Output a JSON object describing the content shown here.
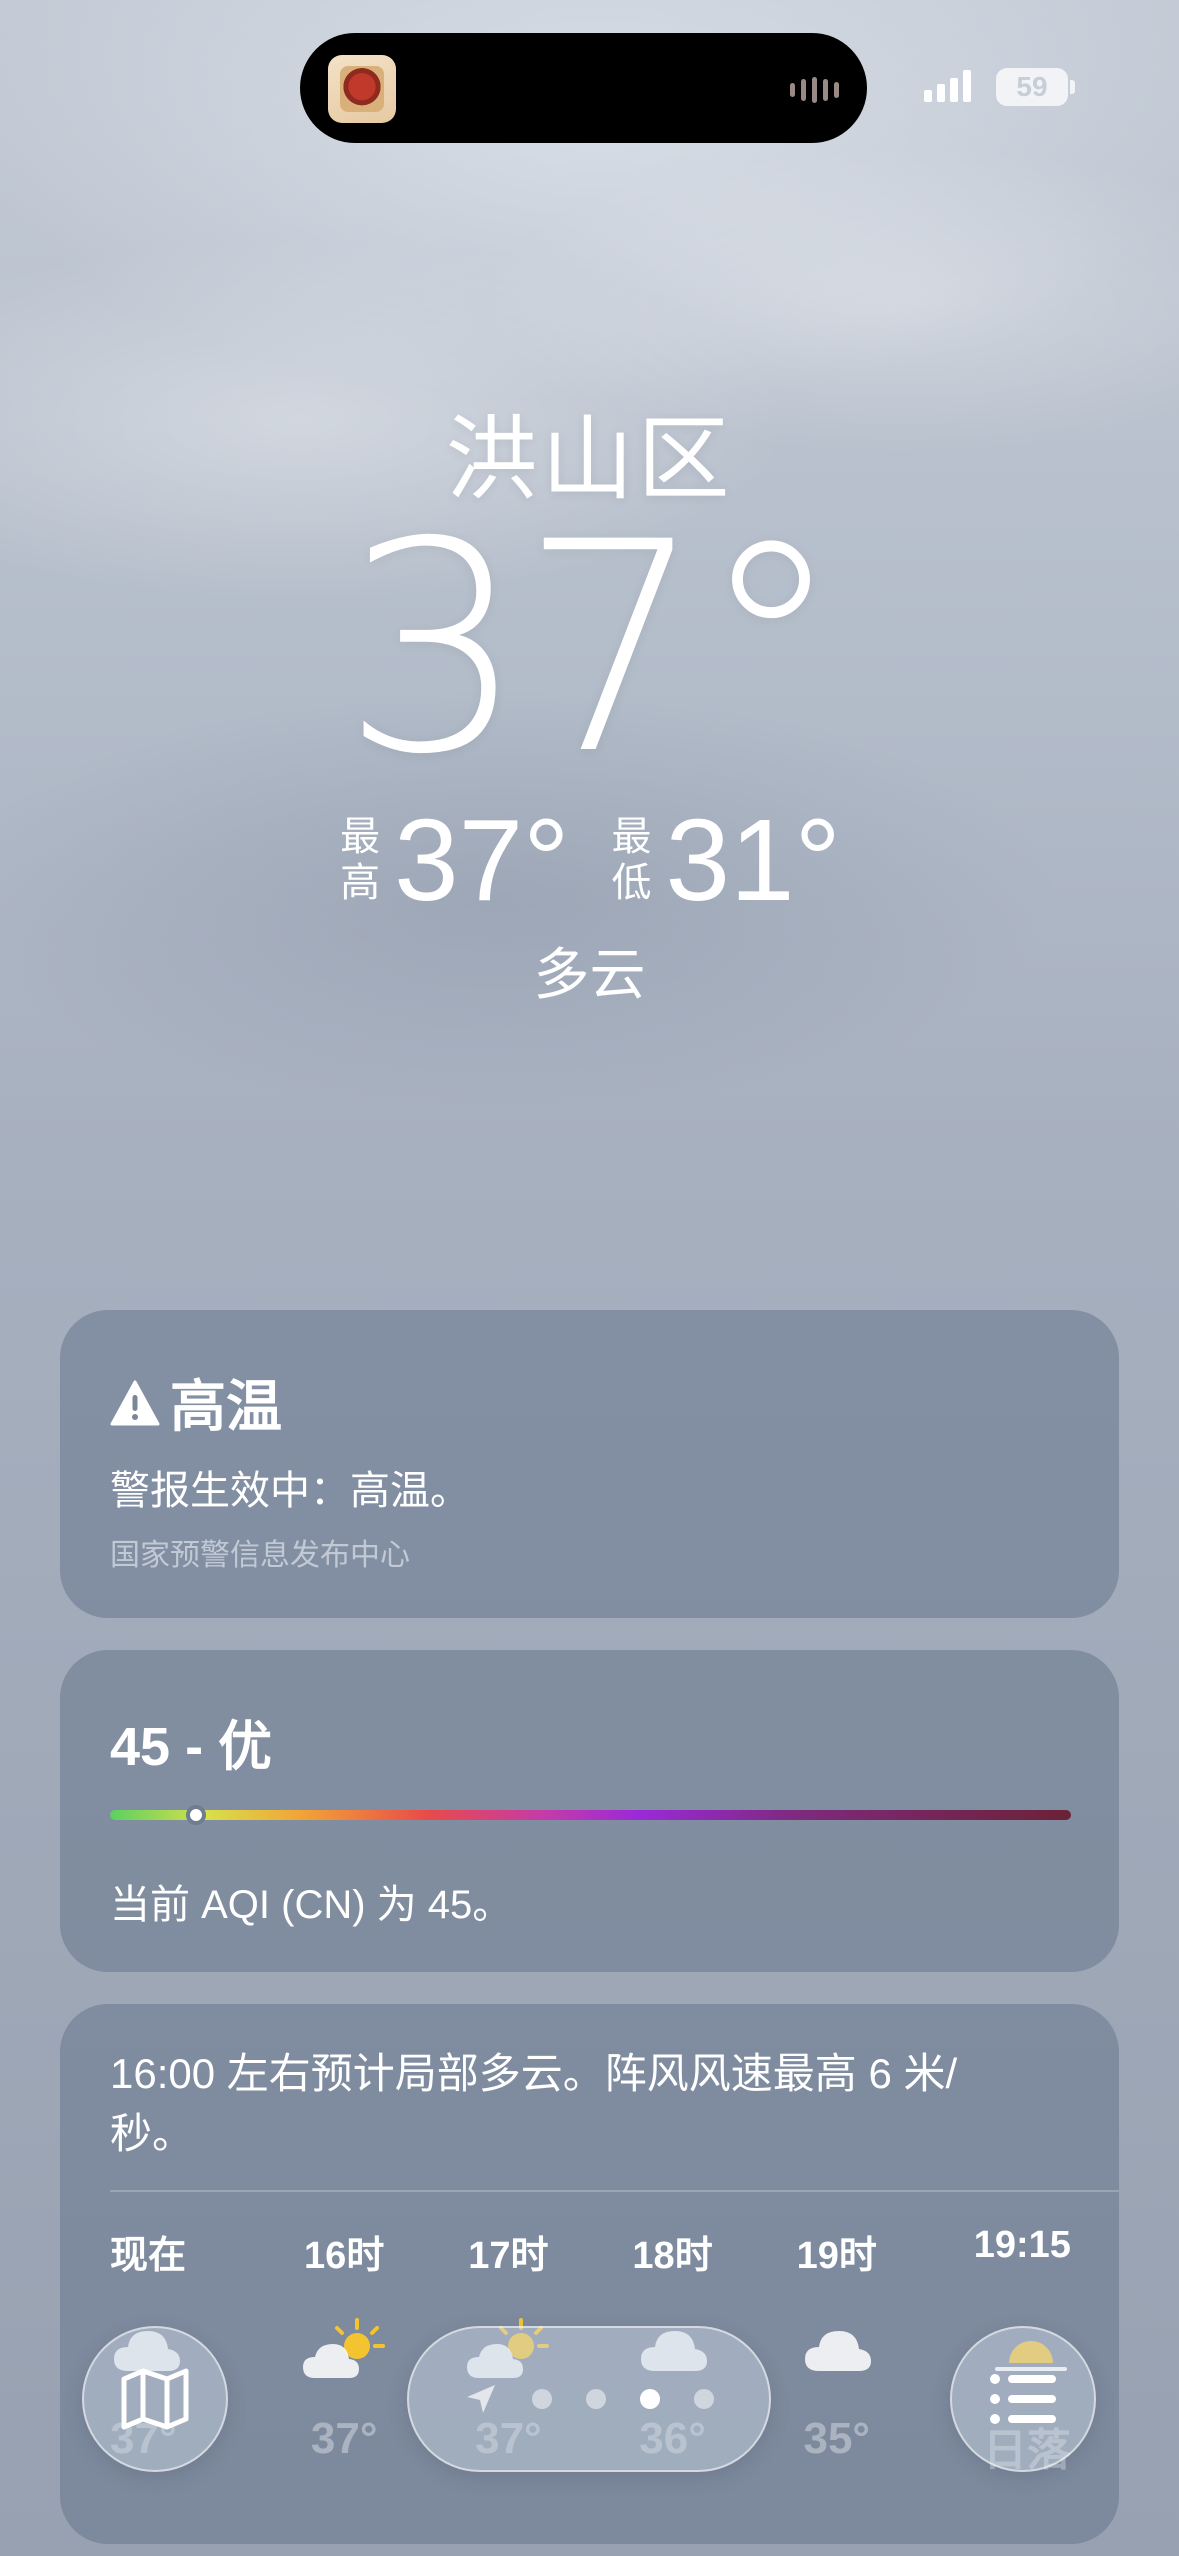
{
  "status_bar": {
    "battery": "59"
  },
  "header": {
    "location": "洪山区",
    "temperature": "37°",
    "high_label_1": "最",
    "high_label_2": "高",
    "high": "37°",
    "low_label_1": "最",
    "low_label_2": "低",
    "low": "31°",
    "condition": "多云"
  },
  "alert_card": {
    "title": "高温",
    "text": "警报生效中：高温。",
    "source": "国家预警信息发布中心"
  },
  "aqi_card": {
    "title": "45 - 优",
    "value": 45,
    "scale_max": 500,
    "description": "当前 AQI (CN) 为 45。"
  },
  "hourly_card": {
    "summary": "16:00 左右预计局部多云。阵风风速最高 6 米/秒。",
    "hours": [
      {
        "time": "现在",
        "icon": "cloud-icon",
        "temp": "37°"
      },
      {
        "time": "16时",
        "icon": "partly-sunny-icon",
        "temp": "37°"
      },
      {
        "time": "17时",
        "icon": "partly-sunny-icon",
        "temp": "37°"
      },
      {
        "time": "18时",
        "icon": "cloud-icon",
        "temp": "36°"
      },
      {
        "time": "19时",
        "icon": "cloud-icon",
        "temp": "35°"
      },
      {
        "time": "19:15",
        "icon": "sunset-icon",
        "temp": "日落"
      }
    ]
  },
  "toolbar": {
    "page_count": 4,
    "active_page": 3
  },
  "colors": {
    "card_bg": "#6e7d96",
    "aqi_good": "#5bd061"
  }
}
